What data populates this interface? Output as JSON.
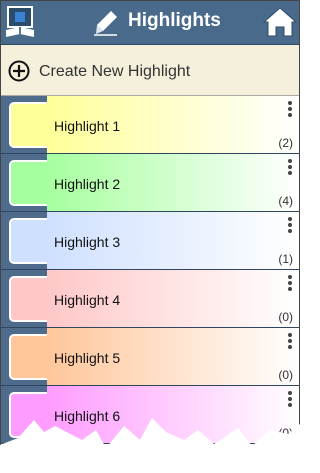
{
  "header": {
    "title": "Highlights",
    "logo_icon": "bible-book-icon",
    "title_icon": "highlighter-pen-icon",
    "home_icon": "home-icon",
    "color": "#4a6a8c"
  },
  "create": {
    "label": "Create New Highlight",
    "icon": "plus-circle-icon"
  },
  "highlights": [
    {
      "label": "Highlight 1",
      "count": "(2)",
      "color": "#ffff99"
    },
    {
      "label": "Highlight 2",
      "count": "(4)",
      "color": "#a6ff9e"
    },
    {
      "label": "Highlight 3",
      "count": "(1)",
      "color": "#cfe0ff"
    },
    {
      "label": "Highlight 4",
      "count": "(0)",
      "color": "#ffc7c7"
    },
    {
      "label": "Highlight 5",
      "count": "(0)",
      "color": "#ffc69a"
    },
    {
      "label": "Highlight 6",
      "count": "(0)",
      "color": "#ff9cff"
    }
  ]
}
